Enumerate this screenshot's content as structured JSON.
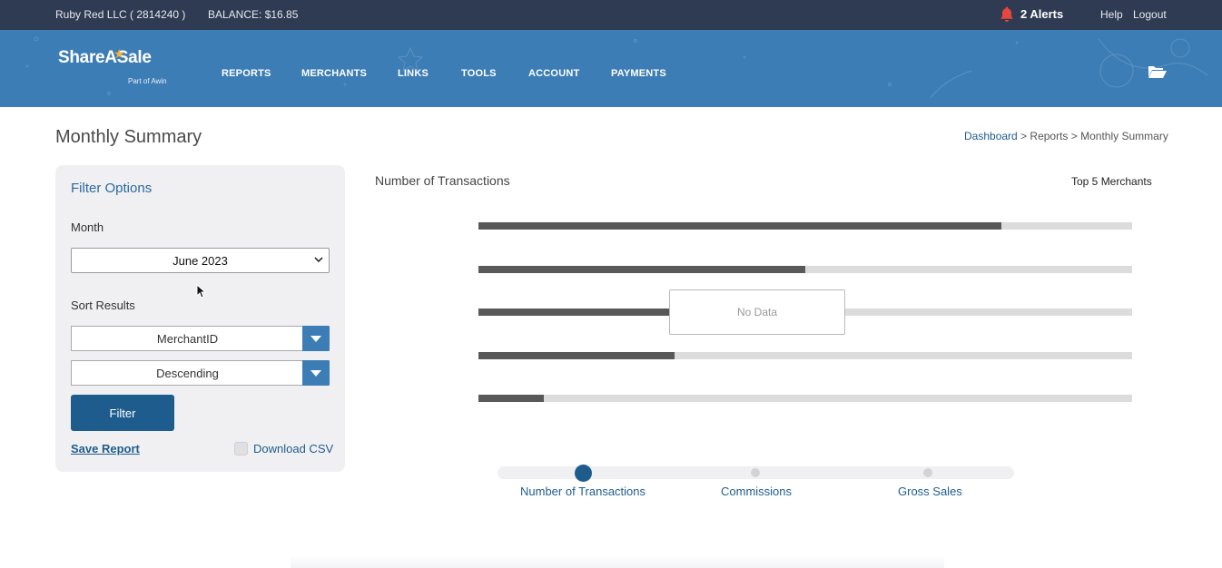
{
  "topbar": {
    "account": "Ruby Red LLC ( 2814240 )",
    "balance": "BALANCE: $16.85",
    "alerts": "2 Alerts",
    "help": "Help",
    "logout": "Logout"
  },
  "header": {
    "logo": "ShareASale",
    "logo_sub": "Part of Awin",
    "nav": [
      "REPORTS",
      "MERCHANTS",
      "LINKS",
      "TOOLS",
      "ACCOUNT",
      "PAYMENTS"
    ]
  },
  "page": {
    "title": "Monthly Summary",
    "breadcrumb": {
      "dashboard": "Dashboard",
      "sep1": " > ",
      "reports": "Reports",
      "sep2": " > ",
      "current": "Monthly Summary"
    }
  },
  "filter": {
    "title": "Filter Options",
    "month_label": "Month",
    "month_value": "June 2023",
    "sort_label": "Sort Results",
    "sort_by": "MerchantID",
    "sort_order": "Descending",
    "filter_button": "Filter",
    "save_report": "Save Report",
    "download_csv": "Download CSV",
    "download_csv_checked": false
  },
  "chart": {
    "title": "Number of Transactions",
    "top_merchants": "Top 5 Merchants",
    "no_data": "No Data",
    "bar_fill_fractions": [
      0.8,
      0.5,
      0.3,
      0.3,
      0.1
    ]
  },
  "tabs": {
    "items": [
      "Number of Transactions",
      "Commissions",
      "Gross Sales"
    ],
    "active": 0
  },
  "colors": {
    "topbar": "#2f3b52",
    "header": "#3d7db5",
    "accent": "#1f5c8e",
    "alert_bell": "#e8453c"
  }
}
